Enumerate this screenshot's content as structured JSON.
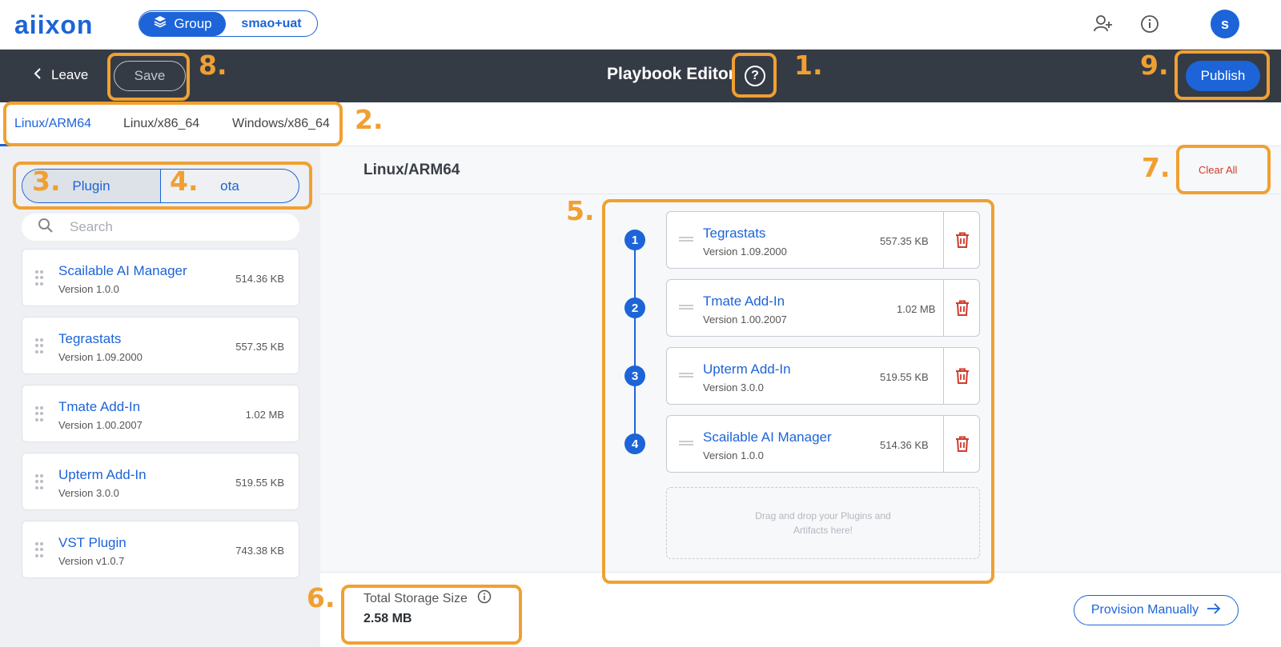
{
  "app": {
    "logo_text": "aiixon"
  },
  "context": {
    "scope_label": "Group",
    "scope_value": "smao+uat"
  },
  "topbar_icons": [
    "add-user-icon",
    "info-icon"
  ],
  "user": {
    "avatar_initial": "s"
  },
  "editor": {
    "leave_label": "Leave",
    "save_label": "Save",
    "title": "Playbook Editor",
    "publish_label": "Publish"
  },
  "tabs": [
    {
      "label": "Linux/ARM64",
      "active": true
    },
    {
      "label": "Linux/x86_64",
      "active": false
    },
    {
      "label": "Windows/x86_64",
      "active": false
    }
  ],
  "library": {
    "segments": [
      {
        "label": "Plugin",
        "active": true
      },
      {
        "label": "ota",
        "active": false
      }
    ],
    "search_placeholder": "Search",
    "items": [
      {
        "name": "Scailable AI Manager",
        "version": "Version 1.0.0",
        "size": "514.36 KB"
      },
      {
        "name": "Tegrastats",
        "version": "Version 1.09.2000",
        "size": "557.35 KB"
      },
      {
        "name": "Tmate Add-In",
        "version": "Version 1.00.2007",
        "size": "1.02 MB"
      },
      {
        "name": "Upterm Add-In",
        "version": "Version 3.0.0",
        "size": "519.55 KB"
      },
      {
        "name": "VST Plugin",
        "version": "Version v1.0.7",
        "size": "743.38 KB"
      }
    ]
  },
  "playbook": {
    "platform_title": "Linux/ARM64",
    "clear_all_label": "Clear All",
    "steps": [
      {
        "num": "1",
        "name": "Tegrastats",
        "version": "Version 1.09.2000",
        "size": "557.35 KB"
      },
      {
        "num": "2",
        "name": "Tmate Add-In",
        "version": "Version 1.00.2007",
        "size": "1.02 MB"
      },
      {
        "num": "3",
        "name": "Upterm Add-In",
        "version": "Version 3.0.0",
        "size": "519.55 KB"
      },
      {
        "num": "4",
        "name": "Scailable AI Manager",
        "version": "Version 1.0.0",
        "size": "514.36 KB"
      }
    ],
    "dropzone_text": "Drag and drop your Plugins and Artifacts here!",
    "storage_label": "Total Storage Size",
    "storage_value": "2.58 MB",
    "provision_label": "Provision Manually"
  },
  "annotations": [
    "1.",
    "2.",
    "3.",
    "4.",
    "5.",
    "6.",
    "7.",
    "8.",
    "9."
  ],
  "colors": {
    "brand": "#1c64d8",
    "header_bg": "#353b45",
    "danger": "#d03b2c",
    "annotation": "#f0a031"
  }
}
